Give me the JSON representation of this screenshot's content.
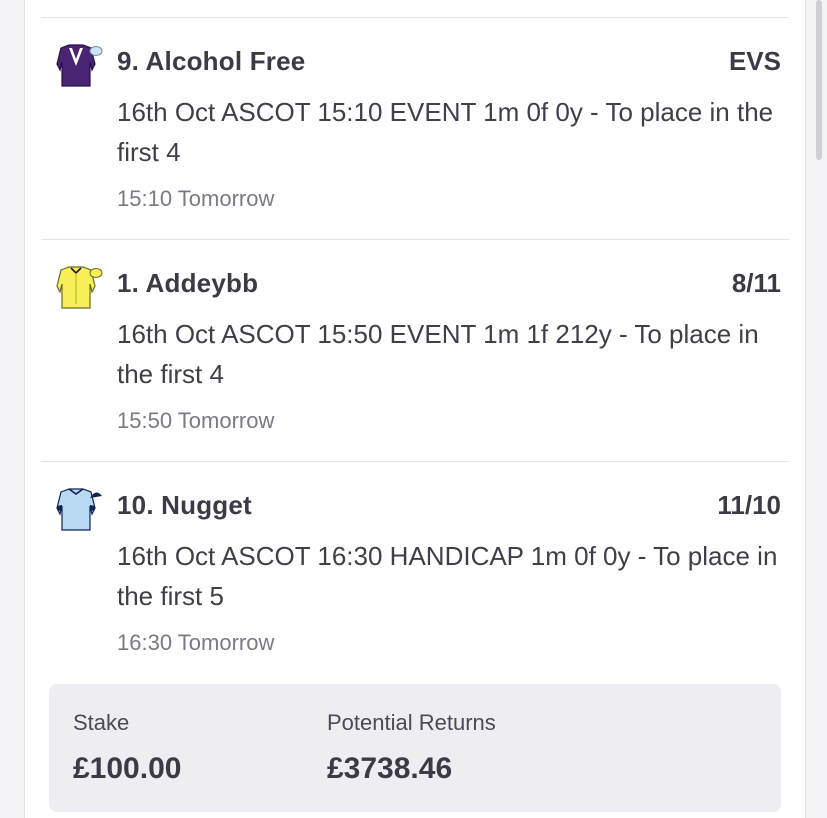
{
  "selections": [
    {
      "runner": "9. Alcohol Free",
      "odds": "EVS",
      "description": "16th Oct ASCOT 15:10 EVENT 1m 0f 0y - To place in the first 4",
      "time": "15:10 Tomorrow",
      "silk": {
        "icon": "silk-purple-white-chevron-icon",
        "body": "#4a2473",
        "accent": "#ffffff",
        "cap": "#cfe3f5"
      }
    },
    {
      "runner": "1. Addeybb",
      "odds": "8/11",
      "description": "16th Oct ASCOT 15:50 EVENT 1m 1f 212y - To place in the first 4",
      "time": "15:50 Tomorrow",
      "silk": {
        "icon": "silk-yellow-icon",
        "body": "#f7ef57",
        "accent": "#1a1a1a",
        "cap": "#f7ef57"
      }
    },
    {
      "runner": "10. Nugget",
      "odds": "11/10",
      "description": "16th Oct ASCOT 16:30 HANDICAP 1m 0f 0y - To place in the first 5",
      "time": "16:30 Tomorrow",
      "silk": {
        "icon": "silk-lightblue-navy-icon",
        "body": "#b9d8f1",
        "accent": "#0d2350",
        "cap": "#0d2350"
      }
    }
  ],
  "summary": {
    "stake_label": "Stake",
    "stake_value": "£100.00",
    "returns_label": "Potential Returns",
    "returns_value": "£3738.46"
  }
}
